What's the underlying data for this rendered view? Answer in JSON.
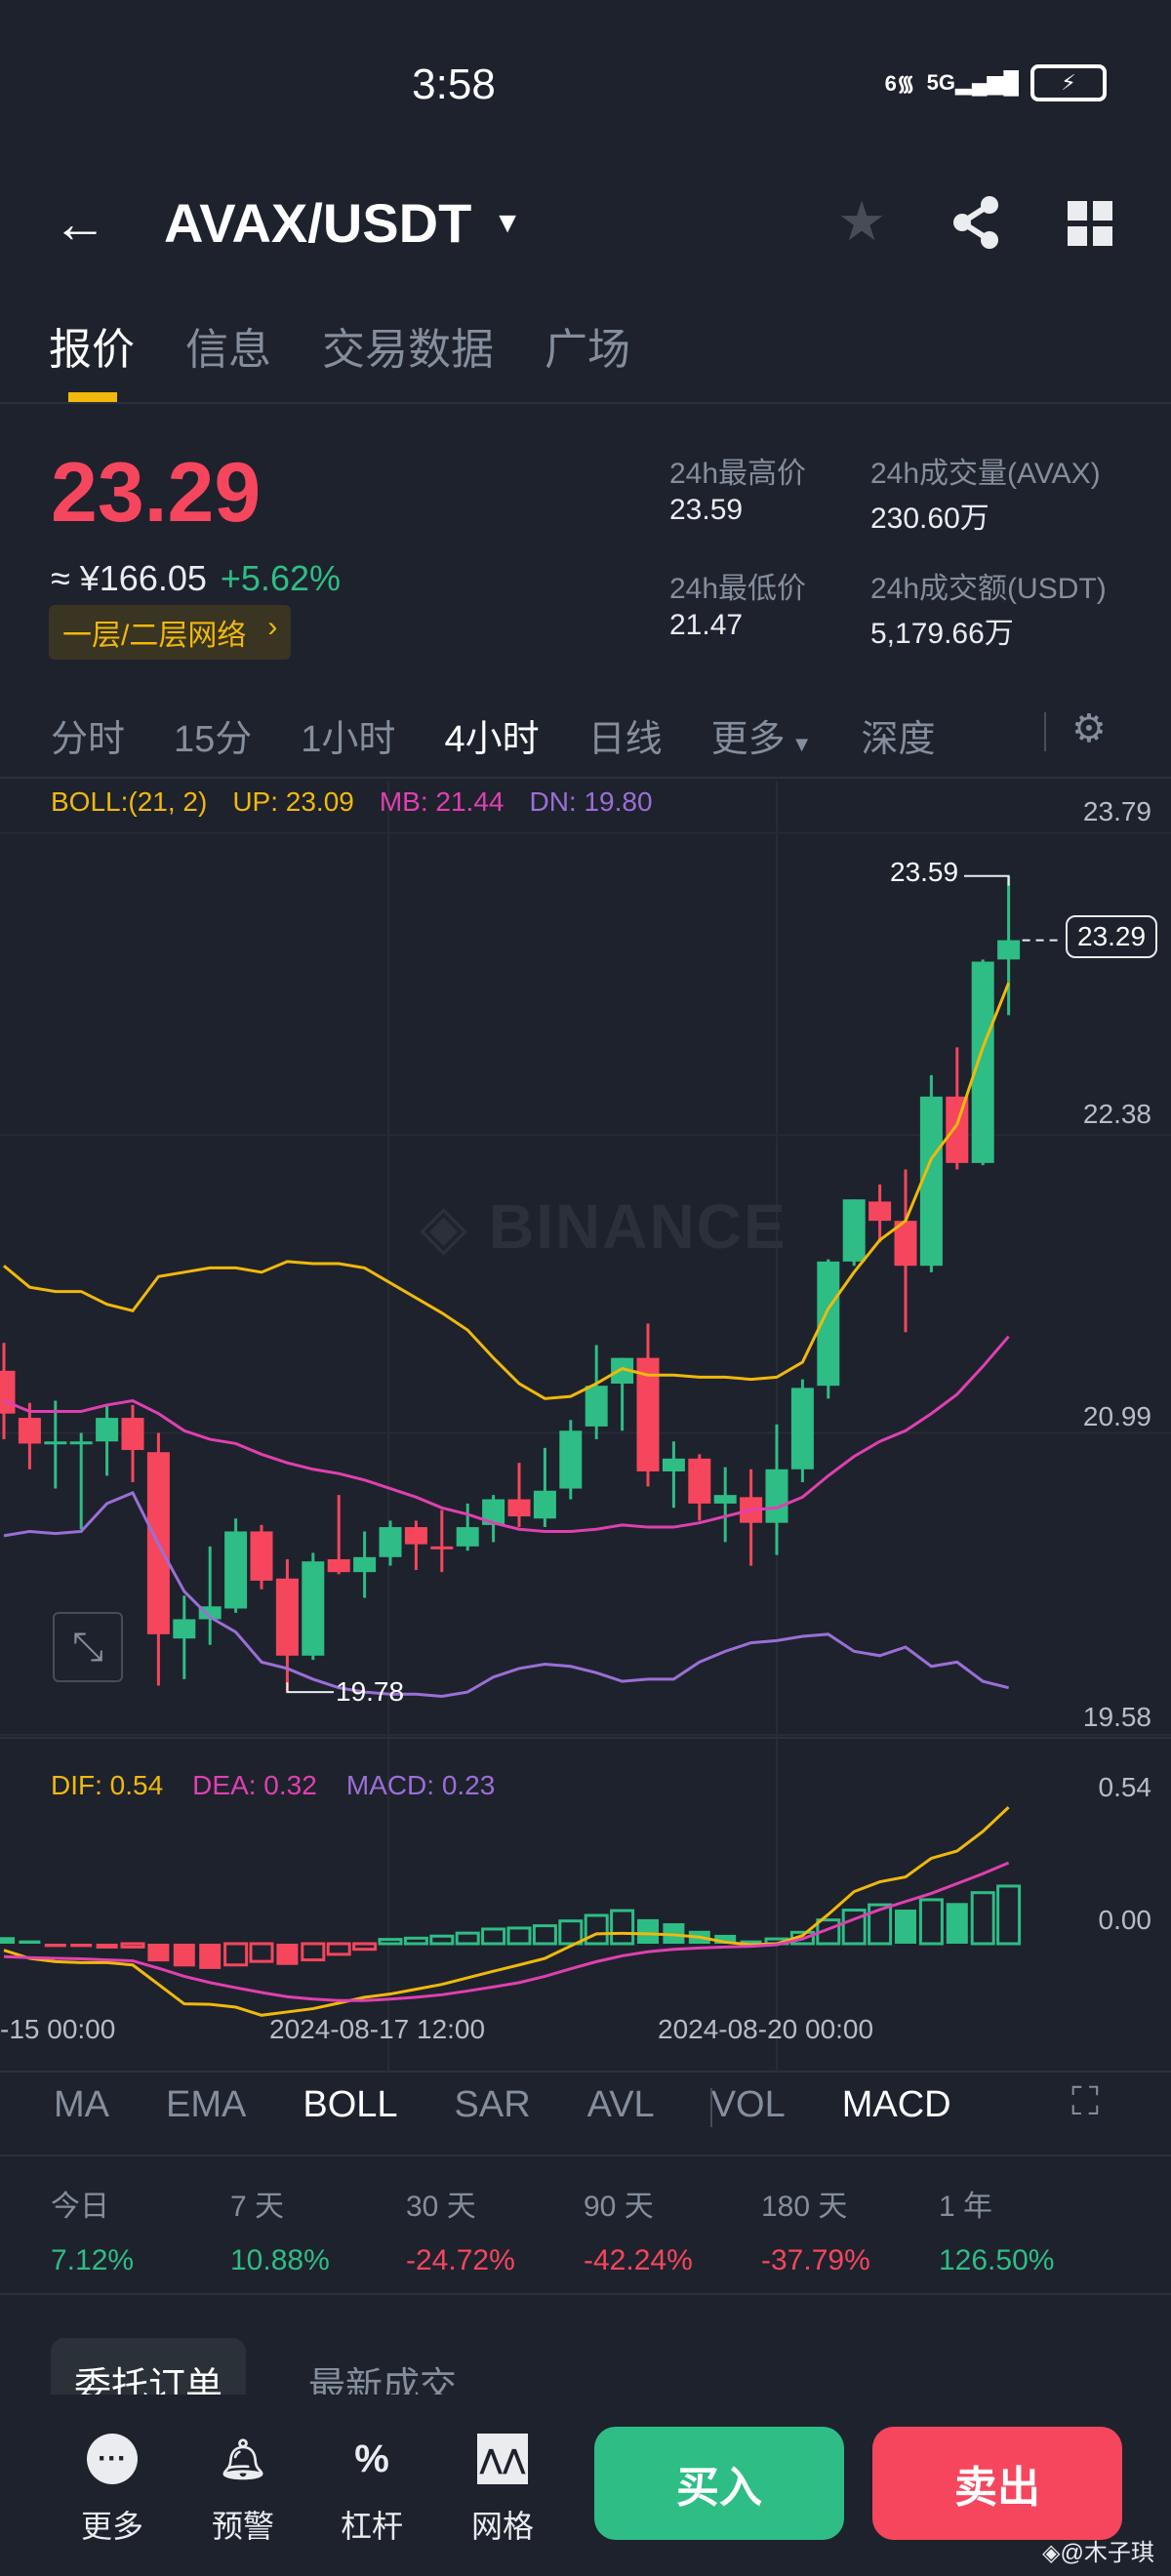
{
  "status": {
    "time": "3:58",
    "wifi": "6",
    "network": "5G"
  },
  "header": {
    "pair": "AVAX/USDT"
  },
  "tabs": [
    "报价",
    "信息",
    "交易数据",
    "广场"
  ],
  "ticker": {
    "price": "23.29",
    "cny": "≈ ¥166.05",
    "change": "+5.62%",
    "badge": "一层/二层网络",
    "stats": [
      {
        "label": "24h最高价",
        "value": "23.59"
      },
      {
        "label": "24h成交量(AVAX)",
        "value": "230.60万"
      },
      {
        "label": "24h最低价",
        "value": "21.47"
      },
      {
        "label": "24h成交额(USDT)",
        "value": "5,179.66万"
      }
    ]
  },
  "timeframes": [
    "分时",
    "15分",
    "1小时",
    "4小时",
    "日线",
    "更多",
    "深度"
  ],
  "colors": {
    "up": "#2ebd85",
    "down": "#f6465d",
    "accent": "#f0b90b",
    "mb": "#e040b0",
    "dn": "#9b6fd6"
  },
  "chart_data": {
    "type": "candlestick",
    "boll_legend": {
      "params": "BOLL:(21, 2)",
      "up": "UP: 23.09",
      "mb": "MB: 21.44",
      "dn": "DN: 19.80"
    },
    "price_axis": [
      "23.79",
      "22.38",
      "20.99",
      "19.58"
    ],
    "ylim": [
      19.58,
      23.79
    ],
    "high_label": "23.59",
    "low_label": "19.78",
    "last_label": "23.29",
    "watermark": "BINANCE",
    "ohlc": [
      [
        21.28,
        21.41,
        20.96,
        21.08
      ],
      [
        21.06,
        21.13,
        20.82,
        20.94
      ],
      [
        20.94,
        21.14,
        20.73,
        20.95
      ],
      [
        20.95,
        20.99,
        20.54,
        20.95
      ],
      [
        20.95,
        21.12,
        20.79,
        21.06
      ],
      [
        21.06,
        21.12,
        20.76,
        20.91
      ],
      [
        20.9,
        20.99,
        19.81,
        20.05
      ],
      [
        20.03,
        20.23,
        19.84,
        20.12
      ],
      [
        20.12,
        20.46,
        20.0,
        20.18
      ],
      [
        20.17,
        20.59,
        20.15,
        20.53
      ],
      [
        20.53,
        20.56,
        20.26,
        20.3
      ],
      [
        20.31,
        20.4,
        19.78,
        19.95
      ],
      [
        19.95,
        20.43,
        19.93,
        20.39
      ],
      [
        20.4,
        20.7,
        20.33,
        20.34
      ],
      [
        20.34,
        20.53,
        20.22,
        20.41
      ],
      [
        20.41,
        20.58,
        20.37,
        20.55
      ],
      [
        20.55,
        20.58,
        20.35,
        20.47
      ],
      [
        20.46,
        20.63,
        20.34,
        20.45
      ],
      [
        20.46,
        20.66,
        20.44,
        20.55
      ],
      [
        20.56,
        20.7,
        20.48,
        20.68
      ],
      [
        20.68,
        20.85,
        20.55,
        20.6
      ],
      [
        20.59,
        20.92,
        20.55,
        20.72
      ],
      [
        20.73,
        21.05,
        20.68,
        21.0
      ],
      [
        21.02,
        21.4,
        20.96,
        21.21
      ],
      [
        21.22,
        21.34,
        21.0,
        21.34
      ],
      [
        21.34,
        21.5,
        20.74,
        20.81
      ],
      [
        20.81,
        20.95,
        20.64,
        20.87
      ],
      [
        20.87,
        20.89,
        20.58,
        20.66
      ],
      [
        20.66,
        20.83,
        20.48,
        20.7
      ],
      [
        20.69,
        20.82,
        20.37,
        20.57
      ],
      [
        20.57,
        21.03,
        20.42,
        20.82
      ],
      [
        20.82,
        21.24,
        20.76,
        21.2
      ],
      [
        21.21,
        21.8,
        21.15,
        21.79
      ],
      [
        21.79,
        22.08,
        21.77,
        22.08
      ],
      [
        22.07,
        22.15,
        21.88,
        21.98
      ],
      [
        21.98,
        22.22,
        21.46,
        21.77
      ],
      [
        21.77,
        22.66,
        21.74,
        22.56
      ],
      [
        22.56,
        22.79,
        22.22,
        22.25
      ],
      [
        22.25,
        23.2,
        22.24,
        23.19
      ],
      [
        23.2,
        23.59,
        22.94,
        23.29
      ]
    ],
    "boll_up": [
      21.77,
      21.67,
      21.65,
      21.65,
      21.59,
      21.56,
      21.72,
      21.74,
      21.76,
      21.76,
      21.74,
      21.79,
      21.78,
      21.78,
      21.76,
      21.69,
      21.62,
      21.55,
      21.47,
      21.34,
      21.22,
      21.15,
      21.16,
      21.22,
      21.29,
      21.26,
      21.26,
      21.25,
      21.25,
      21.24,
      21.25,
      21.32,
      21.57,
      21.74,
      21.89,
      21.98,
      22.27,
      22.43,
      22.79,
      23.09
    ],
    "boll_mb": [
      21.14,
      21.09,
      21.09,
      21.09,
      21.12,
      21.14,
      21.08,
      21.0,
      20.96,
      20.94,
      20.89,
      20.85,
      20.82,
      20.8,
      20.77,
      20.73,
      20.69,
      20.64,
      20.61,
      20.57,
      20.54,
      20.53,
      20.53,
      20.54,
      20.56,
      20.55,
      20.55,
      20.57,
      20.6,
      20.63,
      20.64,
      20.69,
      20.79,
      20.88,
      20.95,
      21.0,
      21.08,
      21.17,
      21.3,
      21.44
    ],
    "boll_dn": [
      20.51,
      20.53,
      20.52,
      20.53,
      20.66,
      20.71,
      20.47,
      20.25,
      20.13,
      20.06,
      19.92,
      19.89,
      19.84,
      19.8,
      19.78,
      19.77,
      19.77,
      19.76,
      19.78,
      19.85,
      19.89,
      19.91,
      19.9,
      19.87,
      19.83,
      19.84,
      19.84,
      19.92,
      19.97,
      20.01,
      20.02,
      20.04,
      20.05,
      19.97,
      19.95,
      19.99,
      19.9,
      19.92,
      19.83,
      19.8
    ],
    "macd_legend": {
      "dif": "DIF: 0.54",
      "dea": "DEA: 0.32",
      "macd": "MACD: 0.23"
    },
    "macd_axis": [
      "0.54",
      "0.00"
    ],
    "macd_hist": [
      0.026,
      0.013,
      -0.013,
      -0.013,
      -0.019,
      -0.013,
      -0.07,
      -0.09,
      -0.1,
      -0.084,
      -0.07,
      -0.084,
      -0.064,
      -0.042,
      -0.022,
      0.017,
      0.022,
      0.03,
      0.042,
      0.058,
      0.062,
      0.071,
      0.09,
      0.112,
      0.131,
      0.097,
      0.081,
      0.051,
      0.035,
      0.013,
      0.019,
      0.045,
      0.094,
      0.133,
      0.154,
      0.135,
      0.174,
      0.161,
      0.202,
      0.228
    ],
    "dif": [
      -0.026,
      -0.058,
      -0.071,
      -0.075,
      -0.075,
      -0.084,
      -0.161,
      -0.238,
      -0.24,
      -0.251,
      -0.283,
      -0.27,
      -0.257,
      -0.235,
      -0.212,
      -0.199,
      -0.18,
      -0.161,
      -0.135,
      -0.109,
      -0.084,
      -0.058,
      -0.009,
      0.039,
      0.041,
      0.039,
      0.035,
      0.026,
      0.006,
      -0.004,
      0.0,
      0.032,
      0.116,
      0.206,
      0.245,
      0.264,
      0.338,
      0.367,
      0.444,
      0.54
    ],
    "dea": [
      -0.051,
      -0.055,
      -0.058,
      -0.06,
      -0.064,
      -0.068,
      -0.097,
      -0.129,
      -0.154,
      -0.174,
      -0.193,
      -0.21,
      -0.219,
      -0.225,
      -0.225,
      -0.219,
      -0.212,
      -0.202,
      -0.187,
      -0.171,
      -0.154,
      -0.129,
      -0.099,
      -0.071,
      -0.048,
      -0.032,
      -0.022,
      -0.017,
      -0.013,
      -0.01,
      -0.004,
      0.019,
      0.058,
      0.097,
      0.135,
      0.167,
      0.199,
      0.238,
      0.277,
      0.32
    ],
    "x_labels": [
      "-15 00:00",
      "2024-08-17 12:00",
      "2024-08-20 00:00"
    ]
  },
  "indicators": [
    "MA",
    "EMA",
    "BOLL",
    "SAR",
    "AVL",
    "VOL",
    "MACD"
  ],
  "performance": [
    {
      "label": "今日",
      "value": "7.12%"
    },
    {
      "label": "7 天",
      "value": "10.88%"
    },
    {
      "label": "30 天",
      "value": "-24.72%"
    },
    {
      "label": "90 天",
      "value": "-42.24%"
    },
    {
      "label": "180 天",
      "value": "-37.79%"
    },
    {
      "label": "1 年",
      "value": "126.50%"
    }
  ],
  "order_tabs": [
    "委托订单",
    "最新成交"
  ],
  "toolbar": [
    {
      "label": "更多"
    },
    {
      "label": "预警"
    },
    {
      "label": "杠杆"
    },
    {
      "label": "网格"
    }
  ],
  "buy": "买入",
  "sell": "卖出",
  "watermark_user": "@木子琪"
}
